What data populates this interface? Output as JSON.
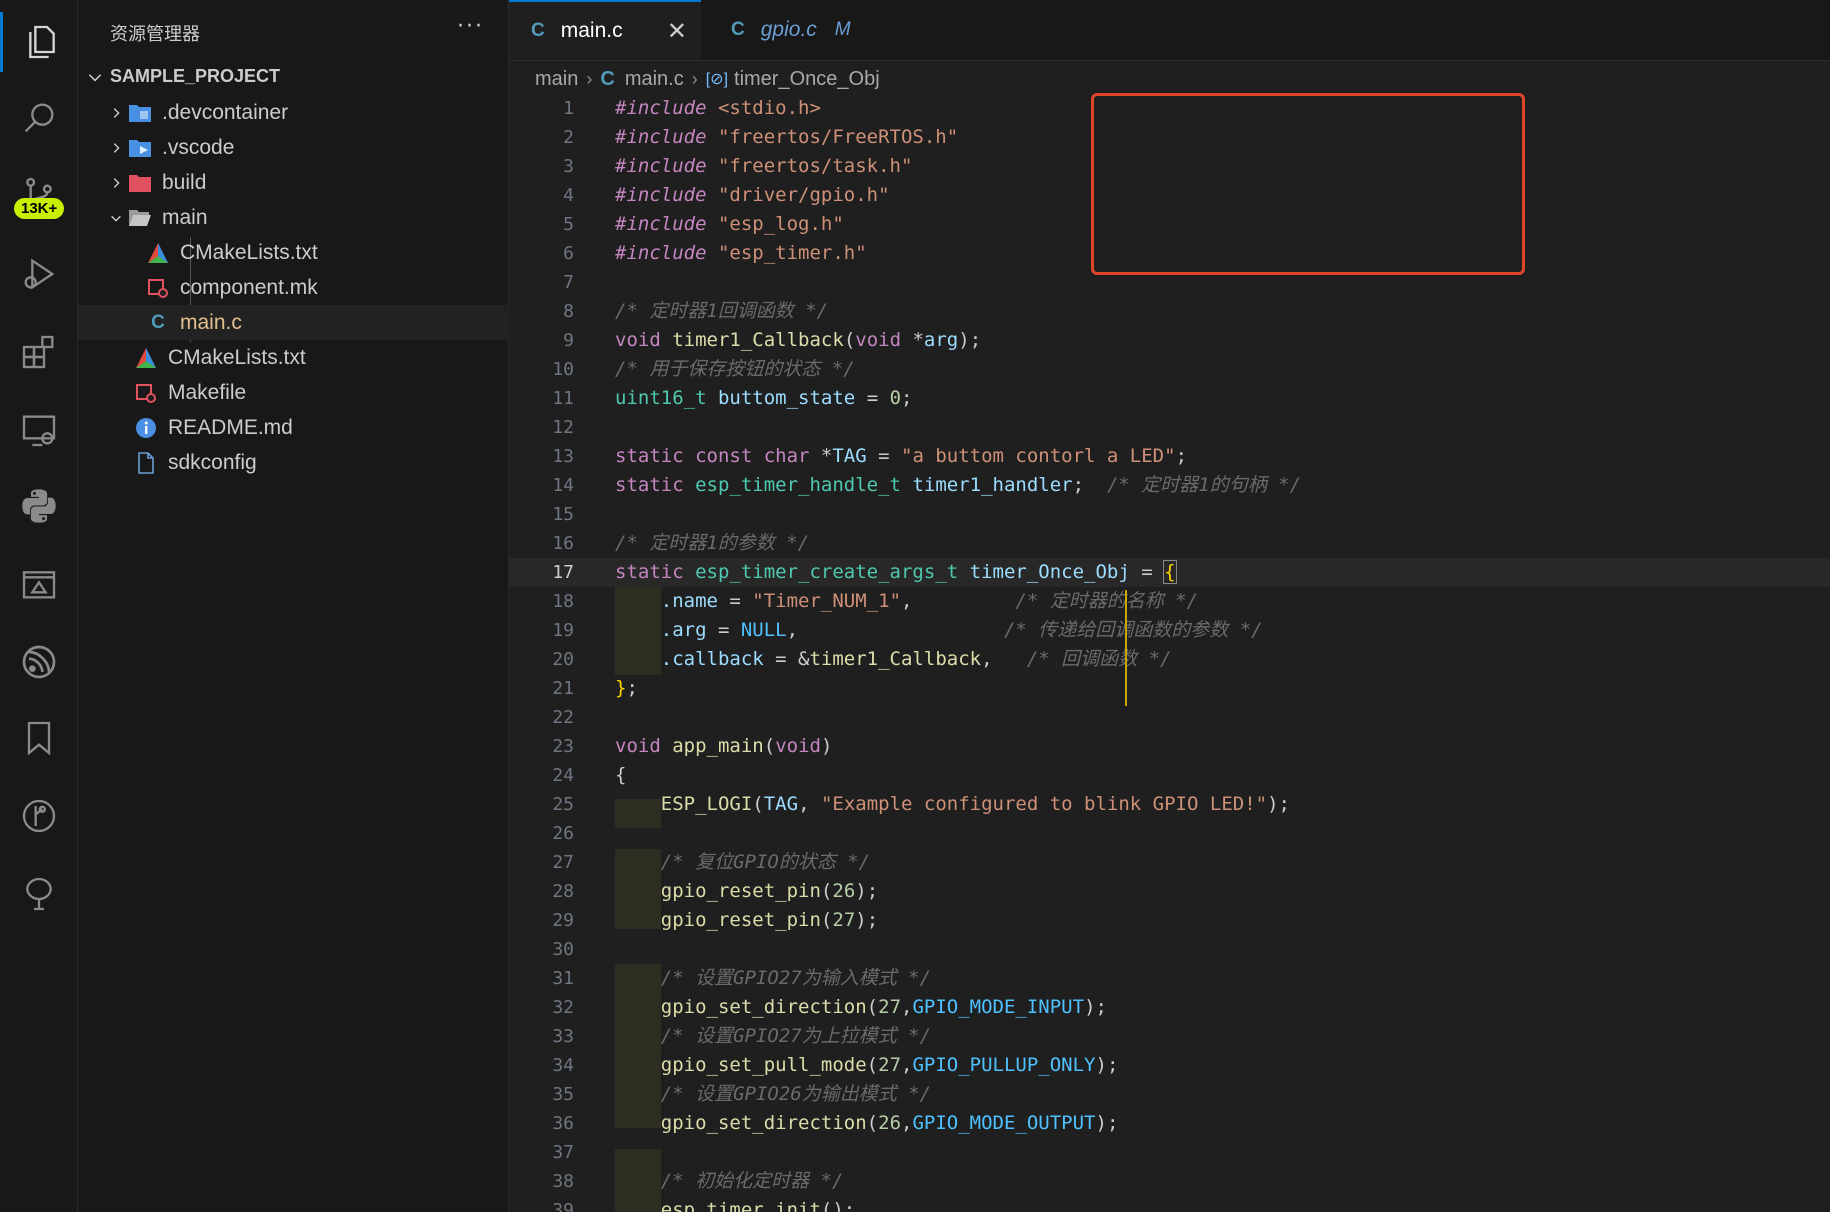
{
  "activity_bar": {
    "items": [
      {
        "icon": "files-icon"
      },
      {
        "icon": "search-icon"
      },
      {
        "icon": "source-control-icon",
        "badge": "13K+"
      },
      {
        "icon": "run-debug-icon"
      },
      {
        "icon": "extensions-icon"
      },
      {
        "icon": "remote-explorer-icon"
      },
      {
        "icon": "python-icon"
      },
      {
        "icon": "image-preview-icon"
      },
      {
        "icon": "espressif-icon"
      },
      {
        "icon": "bookmark-icon"
      },
      {
        "icon": "git-graph-icon"
      },
      {
        "icon": "tree-icon"
      }
    ]
  },
  "sidebar": {
    "title": "资源管理器",
    "more": "···",
    "project": "SAMPLE_PROJECT",
    "tree": [
      {
        "label": ".devcontainer",
        "icon": "folder-devcontainer-icon",
        "color": "#4a90e2"
      },
      {
        "label": ".vscode",
        "icon": "folder-vscode-icon",
        "color": "#4a90e2"
      },
      {
        "label": "build",
        "icon": "folder-build-icon",
        "color": "#e05260"
      },
      {
        "label": "main",
        "icon": "folder-open-icon",
        "color": "#c5c5c5"
      },
      {
        "label": "CMakeLists.txt",
        "icon": "cmake-icon"
      },
      {
        "label": "component.mk",
        "icon": "makefile-icon"
      },
      {
        "label": "main.c",
        "icon": "c-file-icon",
        "color": "#e2c08d"
      },
      {
        "label": "CMakeLists.txt",
        "icon": "cmake-icon"
      },
      {
        "label": "Makefile",
        "icon": "makefile-icon"
      },
      {
        "label": "README.md",
        "icon": "info-icon"
      },
      {
        "label": "sdkconfig",
        "icon": "file-icon"
      }
    ]
  },
  "tabs": [
    {
      "label": "main.c",
      "icon": "C",
      "close": "✕"
    },
    {
      "label": "gpio.c",
      "icon": "C",
      "modified": "M"
    }
  ],
  "breadcrumb": [
    "main",
    "main.c",
    "timer_Once_Obj"
  ],
  "code": {
    "lines": [
      "1",
      "2",
      "3",
      "4",
      "5",
      "6",
      "7",
      "8",
      "9",
      "10",
      "11",
      "12",
      "13",
      "14",
      "15",
      "16",
      "17",
      "18",
      "19",
      "20",
      "21",
      "22",
      "23",
      "24",
      "25",
      "26",
      "27",
      "28",
      "29",
      "30",
      "31",
      "32",
      "33",
      "34",
      "35",
      "36",
      "37",
      "38",
      "39"
    ],
    "include_kw": "#include",
    "inc": [
      "<stdio.h>",
      "\"freertos/FreeRTOS.h\"",
      "\"freertos/task.h\"",
      "\"driver/gpio.h\"",
      "\"esp_log.h\"",
      "\"esp_timer.h\""
    ],
    "c8": "/* 定时器1回调函数 */",
    "c10": "/* 用于保存按钮的状态 */",
    "c16": "/* 定时器1的参数 */",
    "c14": "/* 定时器1的句柄 */",
    "c18": "/* 定时器的名称 */",
    "c19": "/* 传递给回调函数的参数 */",
    "c20": "/* 回调函数 */",
    "c27": "/* 复位GPIO的状态 */",
    "c31": "/* 设置GPIO27为输入模式 */",
    "c33": "/* 设置GPIO27为上拉模式 */",
    "c35": "/* 设置GPIO26为输出模式 */",
    "c38": "/* 初始化定时器 */",
    "s13": "\"a buttom contorl a LED\"",
    "s18": "\"Timer_NUM_1\"",
    "s25": "\"Example configured to blink GPIO LED!\""
  },
  "colors": {
    "accent": "#0078d4",
    "highlight": "#e0452a",
    "badge": "#c6f000"
  }
}
